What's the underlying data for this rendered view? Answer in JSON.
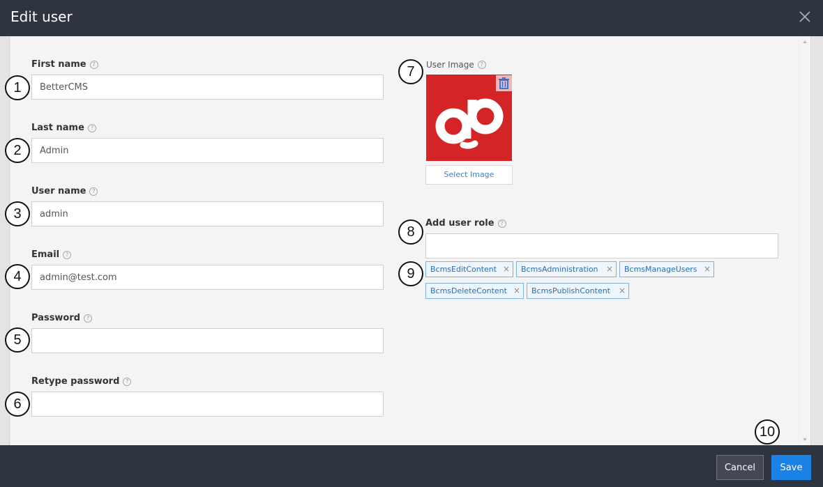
{
  "dialog": {
    "title": "Edit user"
  },
  "form": {
    "first_name": {
      "label": "First name",
      "value": "BetterCMS",
      "marker": "1"
    },
    "last_name": {
      "label": "Last name",
      "value": "Admin",
      "marker": "2"
    },
    "user_name": {
      "label": "User name",
      "value": "admin",
      "marker": "3"
    },
    "email": {
      "label": "Email",
      "value": "admin@test.com",
      "marker": "4"
    },
    "password": {
      "label": "Password",
      "value": "",
      "marker": "5"
    },
    "retype_password": {
      "label": "Retype password",
      "value": "",
      "marker": "6"
    }
  },
  "image": {
    "label": "User Image",
    "select_label": "Select Image",
    "marker": "7"
  },
  "roles": {
    "label": "Add user role",
    "input_value": "",
    "marker": "8",
    "tags_marker": "9",
    "tags": [
      "BcmsEditContent",
      "BcmsAdministration",
      "BcmsManageUsers",
      "BcmsDeleteContent",
      "BcmsPublishContent"
    ],
    "remove_glyph": "×"
  },
  "footer": {
    "marker": "10",
    "cancel_label": "Cancel",
    "save_label": "Save"
  },
  "colors": {
    "header_bg": "#2f3441",
    "save_button": "#1a82e6",
    "image_bg": "#d42426",
    "tag_text": "#2a6db2"
  },
  "icons": {
    "close": "close-icon",
    "help": "help-circle-icon",
    "trash": "trash-icon"
  }
}
